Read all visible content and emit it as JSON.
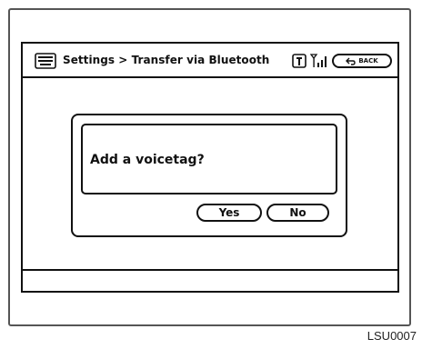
{
  "header": {
    "title": "Settings > Transfer via Bluetooth",
    "phone_icon": "phone-icon",
    "signal_icon": "signal-strength-icon",
    "back_label": "BACK"
  },
  "dialog": {
    "message": "Add a voicetag?",
    "yes_label": "Yes",
    "no_label": "No"
  },
  "figure_code": "LSU0007"
}
